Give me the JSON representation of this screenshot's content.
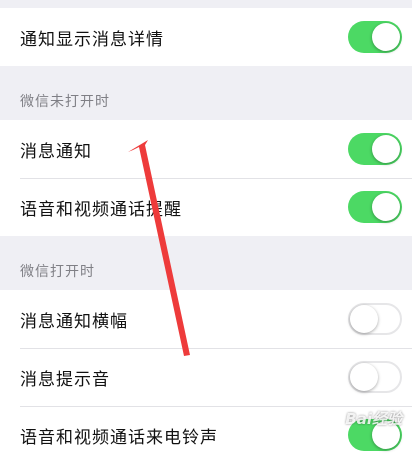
{
  "colors": {
    "toggle_on": "#4cd964",
    "toggle_off": "#ffffff",
    "annotation_arrow": "#ee3b3b",
    "background": "#efeff4"
  },
  "settings": {
    "general": {
      "items": [
        {
          "label": "通知显示消息详情",
          "enabled": true
        }
      ]
    },
    "wechat_closed": {
      "header": "微信未打开时",
      "items": [
        {
          "label": "消息通知",
          "enabled": true
        },
        {
          "label": "语音和视频通话提醒",
          "enabled": true
        }
      ]
    },
    "wechat_open": {
      "header": "微信打开时",
      "items": [
        {
          "label": "消息通知横幅",
          "enabled": false
        },
        {
          "label": "消息提示音",
          "enabled": false
        },
        {
          "label": "语音和视频通话来电铃声",
          "enabled": true
        }
      ]
    }
  },
  "watermark": {
    "text": "Bai经验"
  },
  "annotation": {
    "icon": "red-arrow-icon"
  }
}
